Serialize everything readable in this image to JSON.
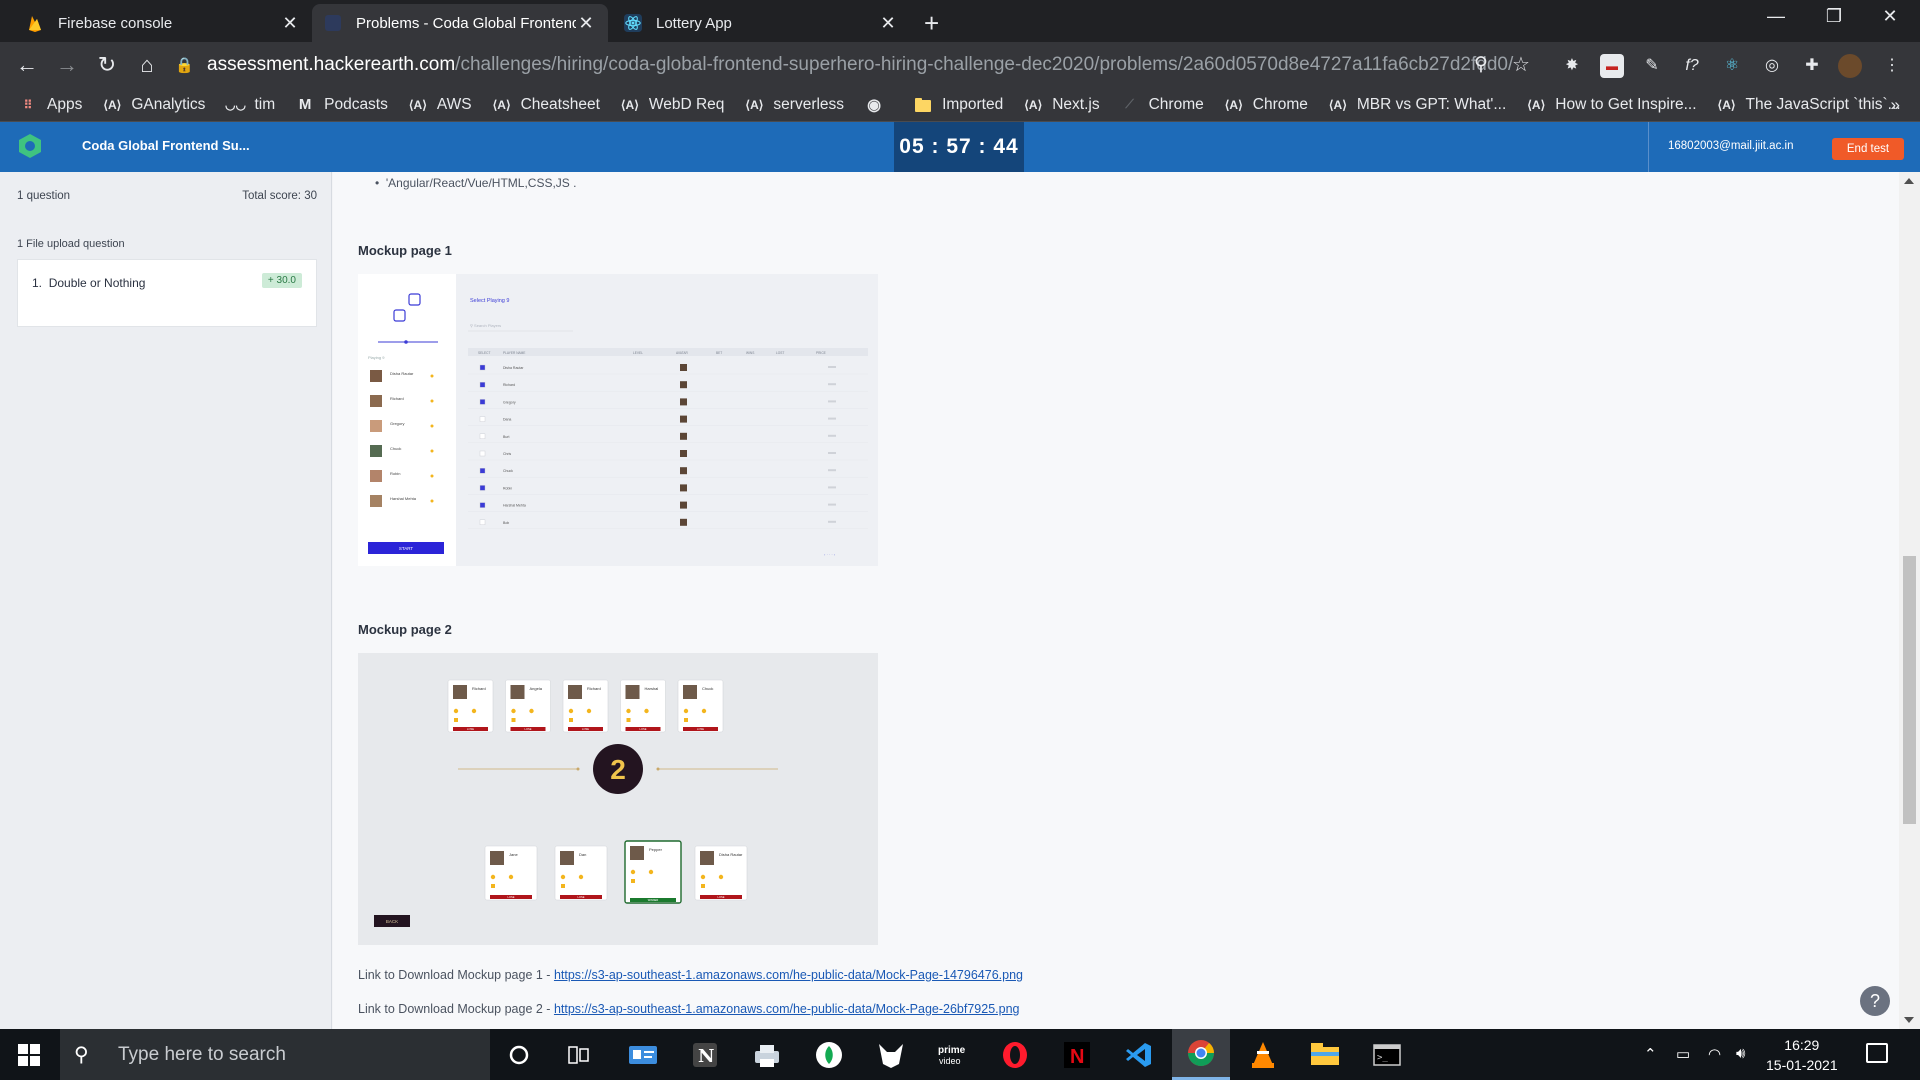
{
  "browser": {
    "tabs": [
      {
        "title": "Firebase console",
        "icon": "firebase-icon",
        "active": false
      },
      {
        "title": "Problems - Coda Global Frontend",
        "icon": "hackerearth-icon",
        "active": true
      },
      {
        "title": "Lottery App",
        "icon": "react-icon",
        "active": false
      }
    ],
    "url_host": "assessment.hackerearth.com",
    "url_path": "/challenges/hiring/coda-global-frontend-superhero-hiring-challenge-dec2020/problems/2a60d0570d8e4727a11fa6cb27d2fdd0/",
    "bookmarks": [
      {
        "label": "Apps",
        "icon": "apps-grid-icon"
      },
      {
        "label": "GAnalytics",
        "icon": "angular-icon"
      },
      {
        "label": "tim",
        "icon": "glasses-icon"
      },
      {
        "label": "Podcasts",
        "icon": "medium-icon"
      },
      {
        "label": "AWS",
        "icon": "angular-icon"
      },
      {
        "label": "Cheatsheet",
        "icon": "angular-icon"
      },
      {
        "label": "WebD Req",
        "icon": "angular-icon"
      },
      {
        "label": "serverless",
        "icon": "angular-icon"
      },
      {
        "label": "",
        "icon": "globe-icon"
      },
      {
        "label": "Imported",
        "icon": "folder-icon"
      },
      {
        "label": "Next.js",
        "icon": "angular-icon"
      },
      {
        "label": "Chrome",
        "icon": "chrome-dev-icon"
      },
      {
        "label": "Chrome",
        "icon": "angular-icon"
      },
      {
        "label": "MBR vs GPT: What'...",
        "icon": "angular-icon"
      },
      {
        "label": "How to Get Inspire...",
        "icon": "angular-icon"
      },
      {
        "label": "The JavaScript `this`...",
        "icon": "angular-icon"
      }
    ],
    "bookmarks_more": "»"
  },
  "app": {
    "title": "Coda Global Frontend Su...",
    "timer": "05 : 57 : 44",
    "user_email": "16802003@mail.jiit.ac.in",
    "end_test_label": "End test"
  },
  "sidebar": {
    "question_count": "1 question",
    "total_score": "Total score: 30",
    "section_label": "1 File upload question",
    "questions": [
      {
        "number": "1.",
        "title": "Double or Nothing",
        "score": "+ 30.0"
      }
    ]
  },
  "main": {
    "bullet_text": "'Angular/React/Vue/HTML,CSS,JS .",
    "mockup1_title": "Mockup page 1",
    "mockup2_title": "Mockup page 2",
    "link1_label": "Link to Download Mockup page 1 - ",
    "link1_url": "https://s3-ap-southeast-1.amazonaws.com/he-public-data/Mock-Page-14796476.png",
    "link2_label": "Link to Download Mockup page 2 - ",
    "link2_url": "https://s3-ap-southeast-1.amazonaws.com/he-public-data/Mock-Page-26bf7925.png",
    "help_label": "?"
  },
  "mockup1": {
    "header": "Select Playing 9",
    "search_placeholder": "Search Players",
    "sidebar_label": "Playing 9",
    "start_label": "START",
    "columns": [
      "SELECT",
      "PLAYER NAME",
      "LEVEL",
      "AVATAR",
      "BET",
      "WINS",
      "LOST",
      "PRICE"
    ],
    "players": [
      {
        "name": "Disha Rautar",
        "checked": true
      },
      {
        "name": "Richard",
        "checked": true
      },
      {
        "name": "Gregory",
        "checked": true
      },
      {
        "name": "Dana",
        "checked": false
      },
      {
        "name": "Burt",
        "checked": false
      },
      {
        "name": "Chris",
        "checked": false
      },
      {
        "name": "Chuck",
        "checked": true
      },
      {
        "name": "Robin",
        "checked": true
      },
      {
        "name": "Harshal Mehta",
        "checked": true
      },
      {
        "name": "Bob",
        "checked": false
      }
    ],
    "left_players": [
      "Disha Rautar",
      "Richard",
      "Gregory",
      "Chuck",
      "Robin",
      "Harshal Mehta"
    ]
  },
  "mockup2": {
    "round_number": "2",
    "back_label": "BACK",
    "top_cards": [
      {
        "name": "Richard",
        "status": "LOSE"
      },
      {
        "name": "Angela",
        "status": "LOSE"
      },
      {
        "name": "Richard",
        "status": "LOSE"
      },
      {
        "name": "Harshal",
        "status": "LOSE"
      },
      {
        "name": "Chuck",
        "status": "LOSE"
      }
    ],
    "bottom_cards": [
      {
        "name": "Jane",
        "status": "LOSE"
      },
      {
        "name": "Dan",
        "status": "LOSE"
      },
      {
        "name": "Pepper",
        "status": "WINNER"
      },
      {
        "name": "Disha Rautar",
        "status": "LOSE"
      }
    ]
  },
  "taskbar": {
    "search_placeholder": "Type here to search",
    "apps": [
      "cortana-icon",
      "task-view-icon",
      "contacts-app-icon",
      "notion-icon",
      "printer-app-icon",
      "app-green-icon",
      "wolf-app-icon",
      "prime-video-icon",
      "opera-icon",
      "netflix-icon",
      "vscode-icon",
      "chrome-icon",
      "vlc-icon",
      "file-explorer-icon",
      "terminal-icon"
    ],
    "time": "16:29",
    "date": "15-01-2021"
  },
  "colors": {
    "header_blue": "#1e6bb8",
    "end_test_orange": "#f05a28",
    "link_blue": "#1a59b5",
    "score_green": "#cdebd7"
  }
}
